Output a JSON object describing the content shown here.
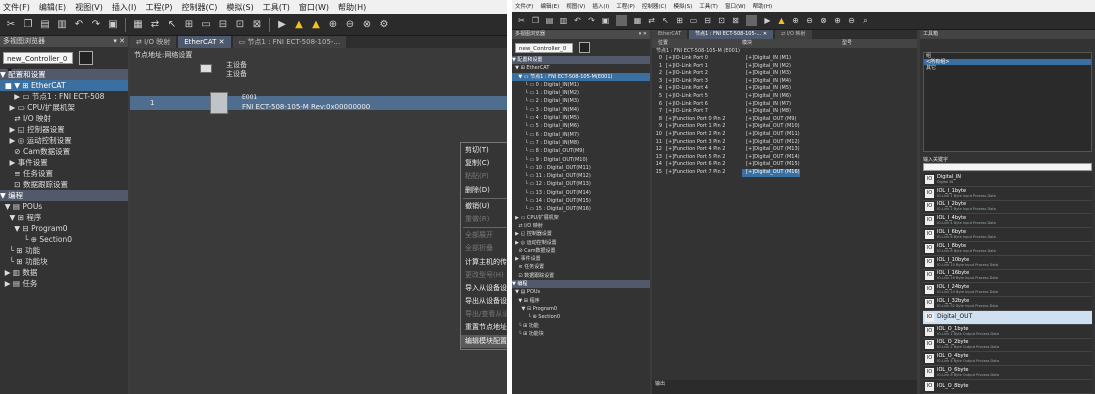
{
  "left": {
    "menu": [
      "文件(F)",
      "编辑(E)",
      "视图(V)",
      "插入(I)",
      "工程(P)",
      "控制器(C)",
      "模拟(S)",
      "工具(T)",
      "窗口(W)",
      "帮助(H)"
    ],
    "nav_title": "多视图浏览器",
    "controller": "new_Controller_0 ▼",
    "tree": [
      {
        "label": "▼ 配置和设置",
        "style": "hd"
      },
      {
        "label": "  ■ ▼ ⊞ EtherCAT",
        "style": "sel"
      },
      {
        "label": "      ▶ ▭ 节点1 : FNI ECT-508",
        "style": ""
      },
      {
        "label": "    ▶ ▭ CPU/扩展机架",
        "style": ""
      },
      {
        "label": "      ⇄ I/O 映射",
        "style": ""
      },
      {
        "label": "    ▶ ◱ 控制器设置",
        "style": ""
      },
      {
        "label": "    ▶ ◎ 运动控制设置",
        "style": ""
      },
      {
        "label": "      ⊘ Cam数据设置",
        "style": ""
      },
      {
        "label": "    ▶ 事件设置",
        "style": ""
      },
      {
        "label": "      ≡ 任务设置",
        "style": ""
      },
      {
        "label": "      ⊡ 数据跟踪设置",
        "style": ""
      },
      {
        "label": "▼ 编程",
        "style": "hd"
      },
      {
        "label": "  ▼ ▤ POUs",
        "style": ""
      },
      {
        "label": "    ▼ ⊞ 程序",
        "style": ""
      },
      {
        "label": "      ▼ ⊟ Program0",
        "style": ""
      },
      {
        "label": "          └ ⊕ Section0",
        "style": ""
      },
      {
        "label": "    └ ⊞ 功能",
        "style": ""
      },
      {
        "label": "    └ ⊞ 功能块",
        "style": ""
      },
      {
        "label": "  ▶ ▥ 数据",
        "style": ""
      },
      {
        "label": "  ▶ ▤ 任务",
        "style": ""
      }
    ],
    "tabs": [
      "⇄ I/O 映射",
      "EtherCAT ✕",
      "▭ 节点1 : FNI ECT-508-105-..."
    ],
    "net_path": "节点地址:网络设置",
    "master_label": "主设备",
    "master_sub": "主设备",
    "slave_no": "1",
    "slave_code": "E001",
    "slave_name": "FNI ECT-508-105-M Rev:0x00000000",
    "context_menu": [
      {
        "label": "剪切(T)",
        "state": ""
      },
      {
        "label": "复制(C)",
        "state": ""
      },
      {
        "label": "粘贴(P)",
        "state": "dis"
      },
      {
        "label": "删除(D)",
        "state": ""
      },
      {
        "label": "",
        "state": "sep"
      },
      {
        "label": "撤销(U)",
        "state": ""
      },
      {
        "label": "重做(R)",
        "state": "dis"
      },
      {
        "label": "",
        "state": "sep"
      },
      {
        "label": "全部展开",
        "state": "dis"
      },
      {
        "label": "全部折叠",
        "state": "dis"
      },
      {
        "label": "计算主机的传送延迟时间(N)",
        "state": ""
      },
      {
        "label": "更改型号(H)",
        "state": "dis"
      },
      {
        "label": "导入从设备设置和插入新从设备(O)",
        "state": ""
      },
      {
        "label": "导出从设备设置(X)",
        "state": ""
      },
      {
        "label": "导出/查看从设备(X)",
        "state": "dis"
      },
      {
        "label": "重置节点地址(A)",
        "state": ""
      },
      {
        "label": "编辑模块配置",
        "state": "hl"
      }
    ]
  },
  "right": {
    "menu": [
      "文件(F)",
      "编辑(E)",
      "视图(V)",
      "插入(I)",
      "工程(P)",
      "控制器(C)",
      "模拟(S)",
      "工具(T)",
      "窗口(W)",
      "帮助(H)"
    ],
    "nav_title": "多视图浏览器",
    "controller": "new_Controller_0 ▼",
    "tree": [
      {
        "label": "▼ 配置和设置",
        "style": "hd"
      },
      {
        "label": "  ▼ ⊞ EtherCAT",
        "style": ""
      },
      {
        "label": "    ▼ ▭ 节点1 : FNI ECT-508-105-M(E001)",
        "style": "sel"
      },
      {
        "label": "        └ ▭ 0 : Digital_IN(M1)",
        "style": ""
      },
      {
        "label": "        └ ▭ 1 : Digital_IN(M2)",
        "style": ""
      },
      {
        "label": "        └ ▭ 2 : Digital_IN(M3)",
        "style": ""
      },
      {
        "label": "        └ ▭ 3 : Digital_IN(M4)",
        "style": ""
      },
      {
        "label": "        └ ▭ 4 : Digital_IN(M5)",
        "style": ""
      },
      {
        "label": "        └ ▭ 5 : Digital_IN(M6)",
        "style": ""
      },
      {
        "label": "        └ ▭ 6 : Digital_IN(M7)",
        "style": ""
      },
      {
        "label": "        └ ▭ 7 : Digital_IN(M8)",
        "style": ""
      },
      {
        "label": "        └ ▭ 8 : Digital_OUT(M9)",
        "style": ""
      },
      {
        "label": "        └ ▭ 9 : Digital_OUT(M10)",
        "style": ""
      },
      {
        "label": "        └ ▭ 10 : Digital_OUT(M11)",
        "style": ""
      },
      {
        "label": "        └ ▭ 11 : Digital_OUT(M12)",
        "style": ""
      },
      {
        "label": "        └ ▭ 12 : Digital_OUT(M13)",
        "style": ""
      },
      {
        "label": "        └ ▭ 13 : Digital_OUT(M14)",
        "style": ""
      },
      {
        "label": "        └ ▭ 14 : Digital_OUT(M15)",
        "style": ""
      },
      {
        "label": "        └ ▭ 15 : Digital_OUT(M16)",
        "style": ""
      },
      {
        "label": "  ▶ ▭ CPU/扩展机架",
        "style": ""
      },
      {
        "label": "    ⇄ I/O 映射",
        "style": ""
      },
      {
        "label": "  ▶ ◱ 控制器设置",
        "style": ""
      },
      {
        "label": "  ▶ ◎ 运动控制设置",
        "style": ""
      },
      {
        "label": "    ⊘ Cam数据设置",
        "style": ""
      },
      {
        "label": "  ▶ 事件设置",
        "style": ""
      },
      {
        "label": "    ≡ 任务设置",
        "style": ""
      },
      {
        "label": "    ⊡ 数据跟踪设置",
        "style": ""
      },
      {
        "label": "▼ 编程",
        "style": "hd"
      },
      {
        "label": "  ▼ ▤ POUs",
        "style": ""
      },
      {
        "label": "    ▼ ⊞ 程序",
        "style": ""
      },
      {
        "label": "      ▼ ⊟ Program0",
        "style": ""
      },
      {
        "label": "          └ ⊕ Section0",
        "style": ""
      },
      {
        "label": "    └ ⊞ 功能",
        "style": ""
      },
      {
        "label": "    └ ⊞ 功能块",
        "style": ""
      }
    ],
    "tabs": [
      "EtherCAT",
      "节点1 : FNI ECT-508-105-... ✕",
      "⇄ I/O 映射"
    ],
    "col_position": "位置",
    "col_module": "模块",
    "col_model": "型号",
    "node_label": "节点1 : FNI ECT-508-105-M (E001)",
    "pdo_rows": [
      {
        "idx": "0",
        "port": "IO-Link Port 0",
        "var": "Digital_IN (M1)"
      },
      {
        "idx": "1",
        "port": "IO-Link Port 1",
        "var": "Digital_IN (M2)"
      },
      {
        "idx": "2",
        "port": "IO-Link Port 2",
        "var": "Digital_IN (M3)"
      },
      {
        "idx": "3",
        "port": "IO-Link Port 3",
        "var": "Digital_IN (M4)"
      },
      {
        "idx": "4",
        "port": "IO-Link Port 4",
        "var": "Digital_IN (M5)"
      },
      {
        "idx": "5",
        "port": "IO-Link Port 5",
        "var": "Digital_IN (M6)"
      },
      {
        "idx": "6",
        "port": "IO-Link Port 6",
        "var": "Digital_IN (M7)"
      },
      {
        "idx": "7",
        "port": "IO-Link Port 7",
        "var": "Digital_IN (M8)"
      },
      {
        "idx": "8",
        "port": "Function Port 0 Pin 2",
        "var": "Digital_OUT (M9)"
      },
      {
        "idx": "9",
        "port": "Function Port 1 Pin 2",
        "var": "Digital_OUT (M10)"
      },
      {
        "idx": "10",
        "port": "Function Port 2 Pin 2",
        "var": "Digital_OUT (M11)"
      },
      {
        "idx": "11",
        "port": "Function Port 3 Pin 2",
        "var": "Digital_OUT (M12)"
      },
      {
        "idx": "12",
        "port": "Function Port 4 Pin 2",
        "var": "Digital_OUT (M13)"
      },
      {
        "idx": "13",
        "port": "Function Port 5 Pin 2",
        "var": "Digital_OUT (M14)"
      },
      {
        "idx": "14",
        "port": "Function Port 6 Pin 2",
        "var": "Digital_OUT (M15)"
      },
      {
        "idx": "15",
        "port": "Function Port 7 Pin 2",
        "var": "Digital_OUT (M16)"
      }
    ],
    "toolbox_title": "工具箱",
    "groups": [
      "组",
      "<所有组>",
      "其它"
    ],
    "keyword_label": "输入关键字",
    "toolbox_items": [
      {
        "name": "Digital_IN",
        "desc": "Digital IN",
        "sel": false
      },
      {
        "name": "IOL_I_1byte",
        "desc": "IO-Link 1 Byte Input Process Data",
        "sel": false
      },
      {
        "name": "IOL_I_2byte",
        "desc": "IO-Link 2 Byte Input Process Data",
        "sel": false
      },
      {
        "name": "IOL_I_4byte",
        "desc": "IO-Link 4 Byte Input Process Data",
        "sel": false
      },
      {
        "name": "IOL_I_6byte",
        "desc": "IO-Link 6 Byte Input Process Data",
        "sel": false
      },
      {
        "name": "IOL_I_8byte",
        "desc": "IO-Link 8 Byte Input Process Data",
        "sel": false
      },
      {
        "name": "IOL_I_10byte",
        "desc": "IO-Link 10 Byte Input Process Data",
        "sel": false
      },
      {
        "name": "IOL_I_16byte",
        "desc": "IO-Link 16 Byte Input Process Data",
        "sel": false
      },
      {
        "name": "IOL_I_24byte",
        "desc": "IO-Link 24 Byte Input Process Data",
        "sel": false
      },
      {
        "name": "IOL_I_32byte",
        "desc": "IO-Link 32 Byte Input Process Data",
        "sel": false
      },
      {
        "name": "Digital_OUT",
        "desc": "",
        "sel": true
      },
      {
        "name": "IOL_O_1byte",
        "desc": "IO-Link 1 Byte Output Process Data",
        "sel": false
      },
      {
        "name": "IOL_O_2byte",
        "desc": "IO-Link 2 Byte Output Process Data",
        "sel": false
      },
      {
        "name": "IOL_O_4byte",
        "desc": "IO-Link 4 Byte Output Process Data",
        "sel": false
      },
      {
        "name": "IOL_O_6byte",
        "desc": "IO-Link 6 Byte Output Process Data",
        "sel": false
      },
      {
        "name": "IOL_O_8byte",
        "desc": "",
        "sel": false
      }
    ],
    "output_label": "输出"
  }
}
